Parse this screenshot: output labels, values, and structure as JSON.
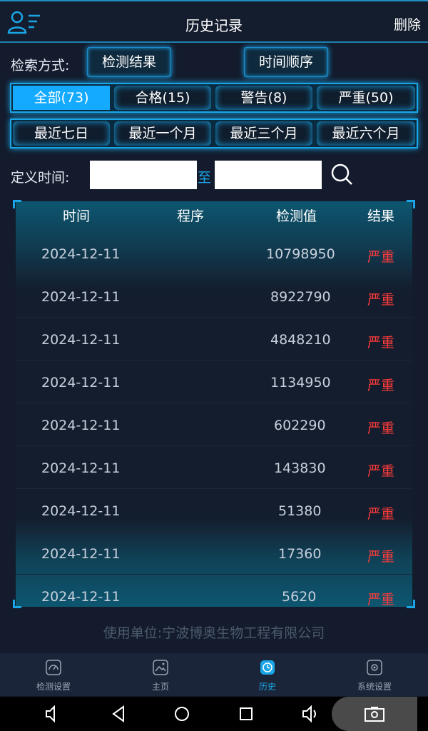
{
  "header": {
    "title": "历史记录",
    "delete_label": "删除"
  },
  "search_mode": {
    "label": "检索方式:",
    "btn_result": "检测结果",
    "btn_time": "时间顺序"
  },
  "filters": [
    {
      "label": "全部(73)",
      "active": true
    },
    {
      "label": "合格(15)",
      "active": false
    },
    {
      "label": "警告(8)",
      "active": false
    },
    {
      "label": "严重(50)",
      "active": false
    }
  ],
  "ranges": [
    {
      "label": "最近七日"
    },
    {
      "label": "最近一个月"
    },
    {
      "label": "最近三个月"
    },
    {
      "label": "最近六个月"
    }
  ],
  "custom_time": {
    "label": "定义时间:",
    "start_value": "",
    "to_label": "至",
    "end_value": ""
  },
  "table": {
    "headers": {
      "time": "时间",
      "program": "程序",
      "value": "检测值",
      "result": "结果"
    },
    "rows": [
      {
        "date": "2024-12-11",
        "program": "",
        "value": "10798950",
        "result": "严重"
      },
      {
        "date": "2024-12-11",
        "program": "",
        "value": "8922790",
        "result": "严重"
      },
      {
        "date": "2024-12-11",
        "program": "",
        "value": "4848210",
        "result": "严重"
      },
      {
        "date": "2024-12-11",
        "program": "",
        "value": "1134950",
        "result": "严重"
      },
      {
        "date": "2024-12-11",
        "program": "",
        "value": "602290",
        "result": "严重"
      },
      {
        "date": "2024-12-11",
        "program": "",
        "value": "143830",
        "result": "严重"
      },
      {
        "date": "2024-12-11",
        "program": "",
        "value": "51380",
        "result": "严重"
      },
      {
        "date": "2024-12-11",
        "program": "",
        "value": "17360",
        "result": "严重"
      },
      {
        "date": "2024-12-11",
        "program": "",
        "value": "5620",
        "result": "严重"
      }
    ]
  },
  "footer": {
    "org_text": "使用单位:宁波博奥生物工程有限公司"
  },
  "nav": [
    {
      "label": "检测设置",
      "icon": "gauge-icon",
      "active": false
    },
    {
      "label": "主页",
      "icon": "image-icon",
      "active": false
    },
    {
      "label": "历史",
      "icon": "history-icon",
      "active": true
    },
    {
      "label": "系统设置",
      "icon": "gear-icon",
      "active": false
    }
  ],
  "colors": {
    "accent": "#1aa6e6",
    "severe": "#ff3b3b",
    "background": "#131b2c"
  }
}
